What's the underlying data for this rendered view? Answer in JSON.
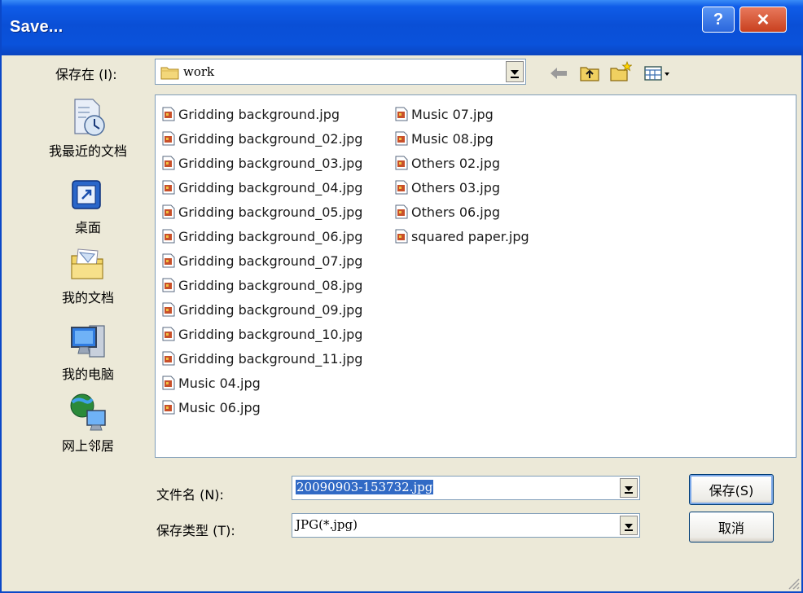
{
  "window": {
    "title": "Save...",
    "help_symbol": "?",
    "close_symbol": "✕"
  },
  "lookin": {
    "label": "保存在 (I):",
    "value": "work"
  },
  "toolbar": {
    "icons": [
      "back-icon",
      "up-folder-icon",
      "new-folder-icon",
      "view-menu-icon"
    ]
  },
  "places": [
    {
      "label": "我最近的文档",
      "icon": "recent-documents-icon"
    },
    {
      "label": "桌面",
      "icon": "desktop-icon"
    },
    {
      "label": "我的文档",
      "icon": "my-documents-icon"
    },
    {
      "label": "我的电脑",
      "icon": "my-computer-icon"
    },
    {
      "label": "网上邻居",
      "icon": "network-places-icon"
    }
  ],
  "files": {
    "col1": [
      "Gridding background.jpg",
      "Gridding background_02.jpg",
      "Gridding background_03.jpg",
      "Gridding background_04.jpg",
      "Gridding background_05.jpg",
      "Gridding background_06.jpg",
      "Gridding background_07.jpg",
      "Gridding background_08.jpg",
      "Gridding background_09.jpg",
      "Gridding background_10.jpg",
      "Gridding background_11.jpg",
      "Music 04.jpg",
      "Music 06.jpg"
    ],
    "col2": [
      "Music 07.jpg",
      "Music 08.jpg",
      "Others 02.jpg",
      "Others 03.jpg",
      "Others 06.jpg",
      "squared paper.jpg"
    ]
  },
  "filename": {
    "label": "文件名 (N):",
    "value": "20090903-153732.jpg"
  },
  "filetype": {
    "label": "保存类型 (T):",
    "value": "JPG(*.jpg)"
  },
  "buttons": {
    "save": "保存(S)",
    "cancel": "取消"
  },
  "colors": {
    "title_bar": "#0a52db",
    "dialog_bg": "#ece9d8",
    "selection": "#316ac5"
  }
}
